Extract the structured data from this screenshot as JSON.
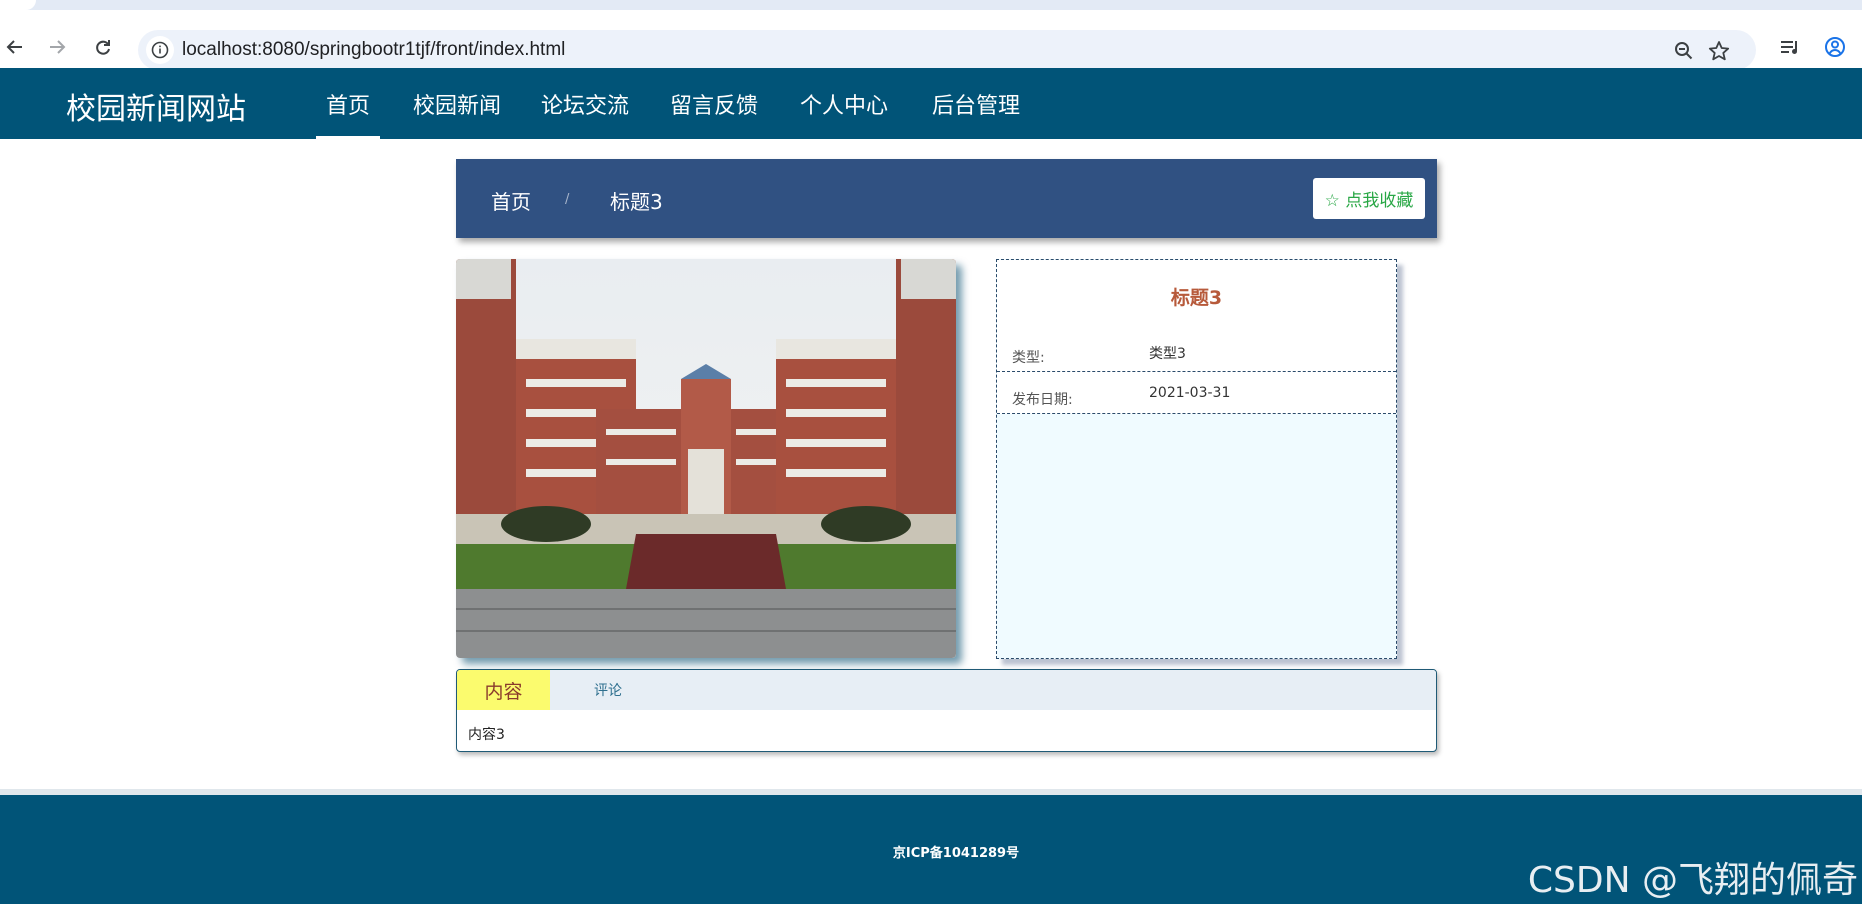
{
  "browser": {
    "url": "localhost:8080/springbootr1tjf/front/index.html"
  },
  "site": {
    "title": "校园新闻网站",
    "nav": [
      "首页",
      "校园新闻",
      "论坛交流",
      "留言反馈",
      "个人中心",
      "后台管理"
    ],
    "active_nav": "首页"
  },
  "breadcrumb": {
    "home": "首页",
    "separator": "/",
    "current": "标题3",
    "favorite_button": "☆ 点我收藏"
  },
  "detail": {
    "title": "标题3",
    "rows": [
      {
        "label": "类型:",
        "value": "类型3"
      },
      {
        "label": "发布日期:",
        "value": "2021-03-31"
      }
    ]
  },
  "tabs": {
    "items": [
      "内容",
      "评论"
    ],
    "active": "内容",
    "content": "内容3"
  },
  "footer": {
    "icp": "京ICP备1041289号"
  },
  "watermark": "CSDN @飞翔的佩奇",
  "colors": {
    "nav_bg": "#015478",
    "crumb_bg": "#305182",
    "favorite_text": "#28a745",
    "detail_title": "#b75a3b",
    "tab_active_bg": "#fbfb6e"
  },
  "icons": {
    "back": "arrow-left-icon",
    "forward": "arrow-right-icon",
    "reload": "reload-icon",
    "site_info": "info-icon",
    "zoom": "zoom-out-icon",
    "bookmark": "star-icon",
    "media": "playlist-icon",
    "profile": "profile-icon"
  }
}
